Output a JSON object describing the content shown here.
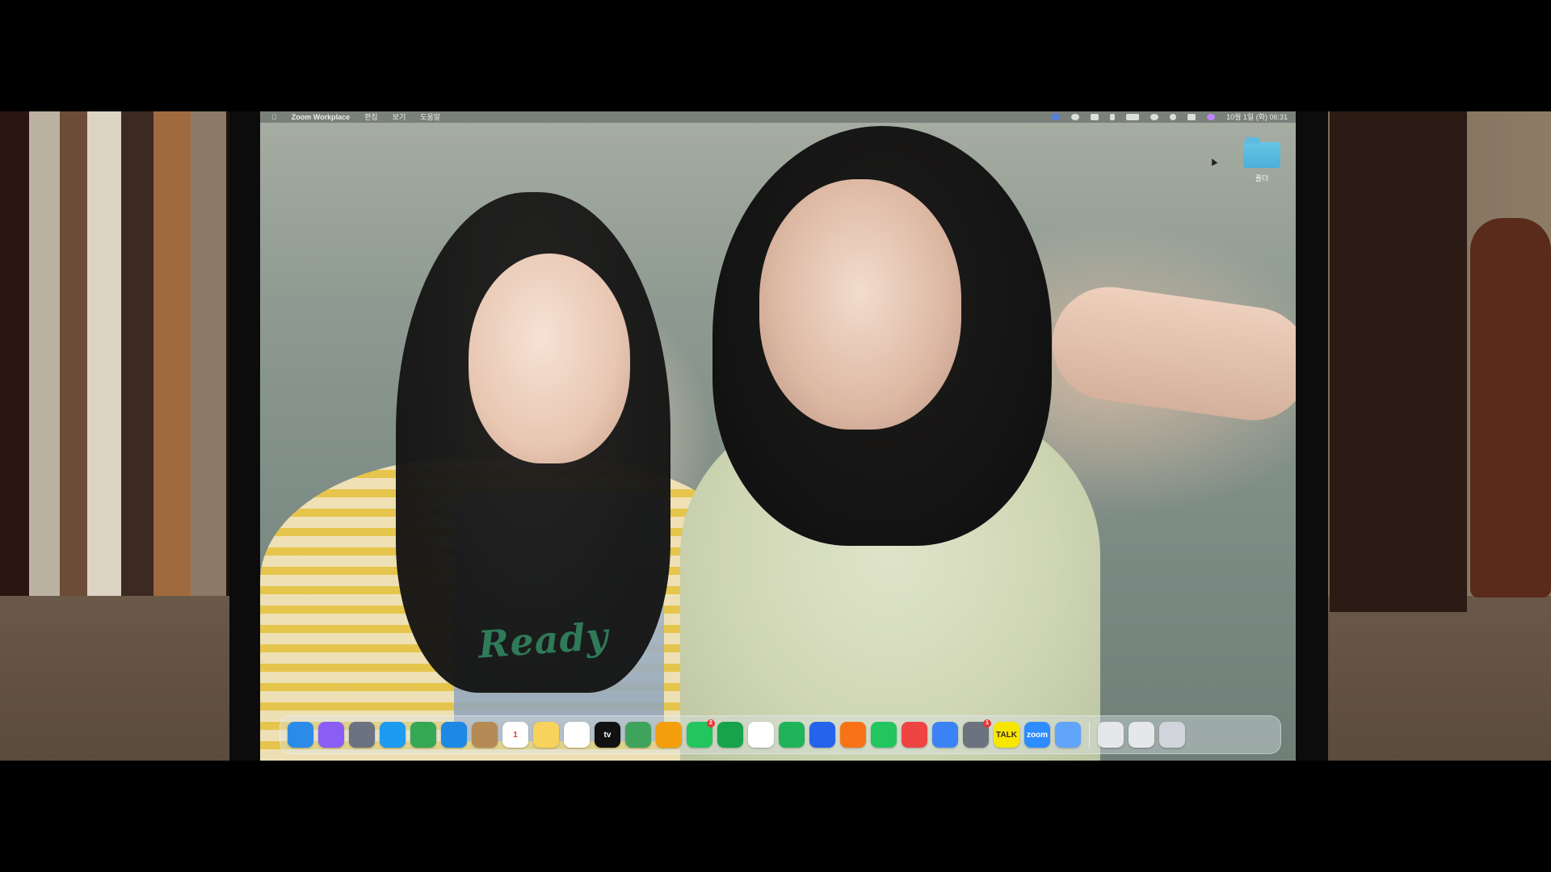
{
  "menubar": {
    "app_name": "Zoom Workplace",
    "menu_items": [
      "편집",
      "보기",
      "도움말"
    ],
    "status_date_time": "10월 1일 (화) 06:31"
  },
  "desktop": {
    "folder_label": "폴더"
  },
  "dock": {
    "items": [
      {
        "name": "finder",
        "label": "",
        "color": "#2b8be8"
      },
      {
        "name": "siri",
        "label": "",
        "color": "#8b5cf6"
      },
      {
        "name": "launchpad",
        "label": "",
        "color": "#6b7280"
      },
      {
        "name": "safari",
        "label": "",
        "color": "#1d9bf0"
      },
      {
        "name": "chrome",
        "label": "",
        "color": "#34a853"
      },
      {
        "name": "mail",
        "label": "",
        "color": "#1e88e5"
      },
      {
        "name": "contacts",
        "label": "",
        "color": "#b58a55"
      },
      {
        "name": "calendar",
        "label": "1",
        "color": "#ffffff"
      },
      {
        "name": "notes",
        "label": "",
        "color": "#f7d35c"
      },
      {
        "name": "freeform",
        "label": "",
        "color": "#ffffff"
      },
      {
        "name": "apple-tv",
        "label": "tv",
        "color": "#111111"
      },
      {
        "name": "maps",
        "label": "",
        "color": "#3fa45b"
      },
      {
        "name": "photos",
        "label": "",
        "color": "#f59e0b"
      },
      {
        "name": "messages",
        "label": "",
        "color": "#22c55e",
        "badge": "2"
      },
      {
        "name": "facetime",
        "label": "",
        "color": "#16a34a"
      },
      {
        "name": "pages",
        "label": "",
        "color": "#ffffff"
      },
      {
        "name": "numbers",
        "label": "",
        "color": "#1fb35a"
      },
      {
        "name": "keynote",
        "label": "",
        "color": "#2563eb"
      },
      {
        "name": "books",
        "label": "",
        "color": "#f97316"
      },
      {
        "name": "find-my",
        "label": "",
        "color": "#22c55e"
      },
      {
        "name": "music",
        "label": "",
        "color": "#ef4444"
      },
      {
        "name": "app-store",
        "label": "",
        "color": "#3b82f6"
      },
      {
        "name": "system-settings",
        "label": "",
        "color": "#6b7280",
        "badge": "1"
      },
      {
        "name": "kakaotalk",
        "label": "TALK",
        "color": "#f7e600"
      },
      {
        "name": "zoom",
        "label": "zoom",
        "color": "#2d8cff"
      },
      {
        "name": "preview",
        "label": "",
        "color": "#60a5fa"
      }
    ],
    "right_items": [
      {
        "name": "keyboard-viewer",
        "label": "",
        "color": "#e5e7eb"
      },
      {
        "name": "downloads",
        "label": "",
        "color": "#e5e7eb"
      },
      {
        "name": "trash",
        "label": "",
        "color": "#d1d5db"
      }
    ]
  },
  "colors": {
    "menubar_bg": "#282e30",
    "folder_blue": "#4ab0d8",
    "ready_green": "#2f7a58"
  },
  "wallpaper": {
    "shirt_text": "Ready"
  }
}
